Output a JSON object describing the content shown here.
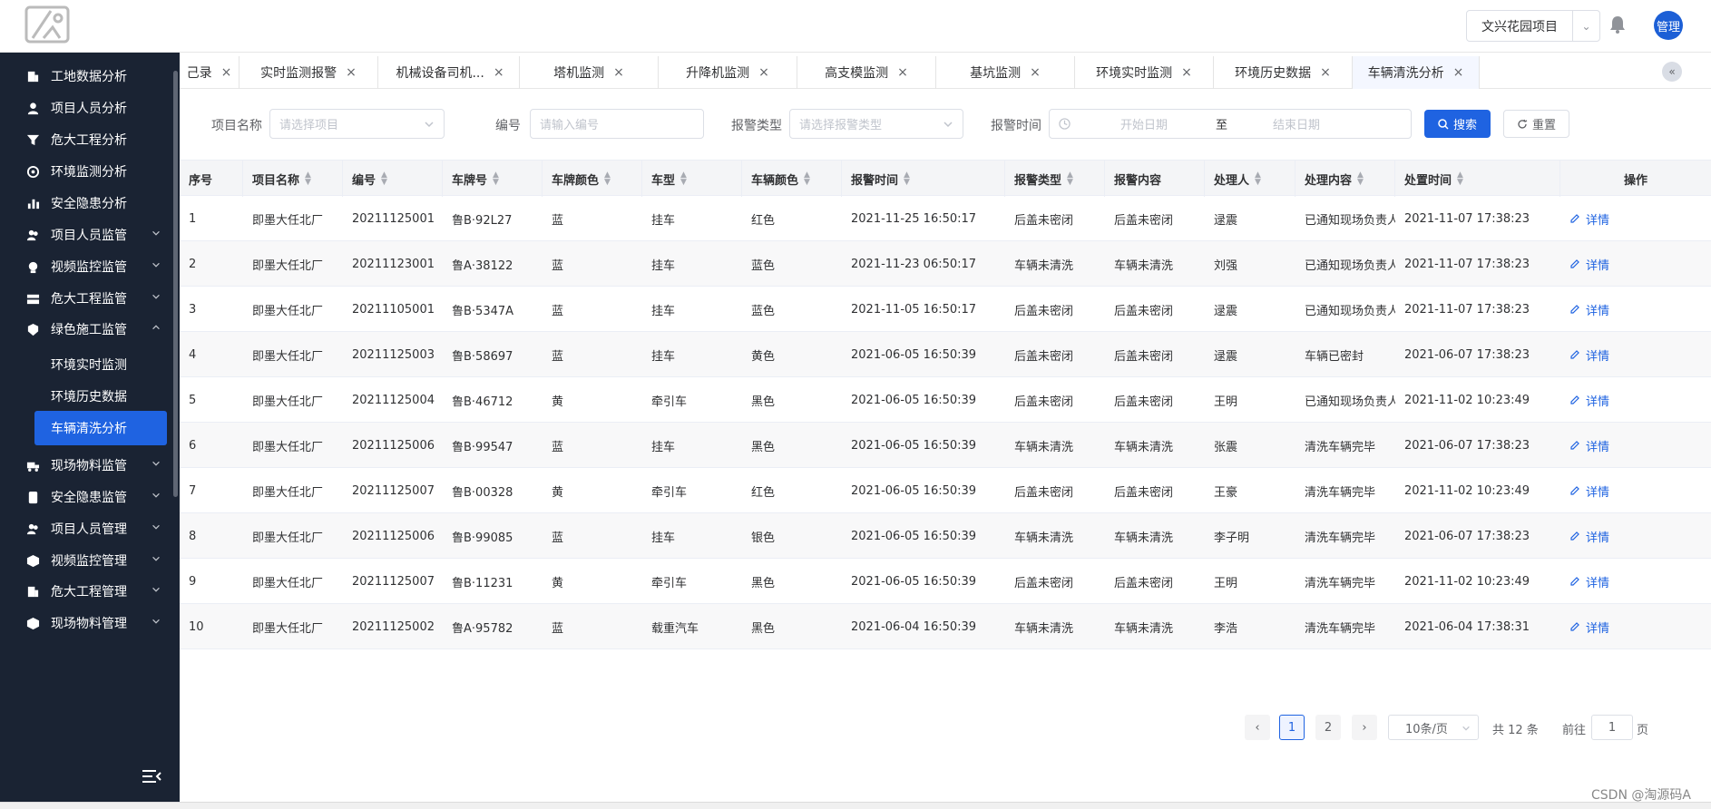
{
  "header": {
    "project_select": "文兴花园项目",
    "avatar_label": "管理"
  },
  "sidebar": {
    "items": [
      {
        "label": "工地数据分析",
        "icon": "building-icon",
        "has_chevron": false
      },
      {
        "label": "项目人员分析",
        "icon": "person-icon",
        "has_chevron": false
      },
      {
        "label": "危大工程分析",
        "icon": "filter-icon",
        "has_chevron": false
      },
      {
        "label": "环境监测分析",
        "icon": "fan-icon",
        "has_chevron": false
      },
      {
        "label": "安全隐患分析",
        "icon": "bar-chart-icon",
        "has_chevron": false
      },
      {
        "label": "项目人员监管",
        "icon": "people-icon",
        "has_chevron": true
      },
      {
        "label": "视频监控监管",
        "icon": "camera-icon",
        "has_chevron": true
      },
      {
        "label": "危大工程监管",
        "icon": "machine-icon",
        "has_chevron": true
      },
      {
        "label": "绿色施工监管",
        "icon": "leaf-icon",
        "has_chevron": true,
        "expanded": true
      },
      {
        "label": "现场物料监管",
        "icon": "truck-icon",
        "has_chevron": true
      },
      {
        "label": "安全隐患监管",
        "icon": "badge-icon",
        "has_chevron": true
      },
      {
        "label": "项目人员管理",
        "icon": "people-icon",
        "has_chevron": true
      },
      {
        "label": "视频监控管理",
        "icon": "cube-icon",
        "has_chevron": true
      },
      {
        "label": "危大工程管理",
        "icon": "building-icon",
        "has_chevron": true
      },
      {
        "label": "现场物料管理",
        "icon": "cube-icon",
        "has_chevron": true
      }
    ],
    "subitems": [
      {
        "label": "环境实时监测",
        "active": false
      },
      {
        "label": "环境历史数据",
        "active": false
      },
      {
        "label": "车辆清洗分析",
        "active": true
      }
    ]
  },
  "tabs": [
    {
      "label": "己录",
      "active": false
    },
    {
      "label": "实时监测报警",
      "active": false
    },
    {
      "label": "机械设备司机...",
      "active": false
    },
    {
      "label": "塔机监测",
      "active": false
    },
    {
      "label": "升降机监测",
      "active": false
    },
    {
      "label": "高支模监测",
      "active": false
    },
    {
      "label": "基坑监测",
      "active": false
    },
    {
      "label": "环境实时监测",
      "active": false
    },
    {
      "label": "环境历史数据",
      "active": false
    },
    {
      "label": "车辆清洗分析",
      "active": true
    }
  ],
  "filters": {
    "project_label": "项目名称",
    "project_placeholder": "请选择项目",
    "code_label": "编号",
    "code_placeholder": "请输入编号",
    "alarm_type_label": "报警类型",
    "alarm_type_placeholder": "请选择报警类型",
    "alarm_time_label": "报警时间",
    "start_placeholder": "开始日期",
    "range_sep": "至",
    "end_placeholder": "结束日期",
    "search_button": "搜索",
    "reset_button": "重置"
  },
  "table": {
    "headers": [
      "序号",
      "项目名称",
      "编号",
      "车牌号",
      "车牌颜色",
      "车型",
      "车辆颜色",
      "报警时间",
      "报警类型",
      "报警内容",
      "处理人",
      "处理内容",
      "处置时间",
      "操作"
    ],
    "rows": [
      [
        "1",
        "即墨大任北厂",
        "20211125001",
        "鲁B·92L27",
        "蓝",
        "挂车",
        "红色",
        "2021-11-25 16:50:17",
        "后盖未密闭",
        "后盖未密闭",
        "逯震",
        "已通知现场负责人",
        "2021-11-07 17:38:23",
        "详情"
      ],
      [
        "2",
        "即墨大任北厂",
        "20211123001",
        "鲁A·38122",
        "蓝",
        "挂车",
        "蓝色",
        "2021-11-23 06:50:17",
        "车辆未清洗",
        "车辆未清洗",
        "刘强",
        "已通知现场负责人",
        "2021-11-07 17:38:23",
        "详情"
      ],
      [
        "3",
        "即墨大任北厂",
        "20211105001",
        "鲁B·5347A",
        "蓝",
        "挂车",
        "蓝色",
        "2021-11-05 16:50:17",
        "后盖未密闭",
        "后盖未密闭",
        "逯震",
        "已通知现场负责人",
        "2021-11-07 17:38:23",
        "详情"
      ],
      [
        "4",
        "即墨大任北厂",
        "20211125003",
        "鲁B·58697",
        "蓝",
        "挂车",
        "黄色",
        "2021-06-05 16:50:39",
        "后盖未密闭",
        "后盖未密闭",
        "逯震",
        "车辆已密封",
        "2021-06-07 17:38:23",
        "详情"
      ],
      [
        "5",
        "即墨大任北厂",
        "20211125004",
        "鲁B·46712",
        "黄",
        "牵引车",
        "黑色",
        "2021-06-05 16:50:39",
        "后盖未密闭",
        "后盖未密闭",
        "王明",
        "已通知现场负责人",
        "2021-11-02 10:23:49",
        "详情"
      ],
      [
        "6",
        "即墨大任北厂",
        "20211125006",
        "鲁B·99547",
        "蓝",
        "挂车",
        "黑色",
        "2021-06-05 16:50:39",
        "车辆未清洗",
        "车辆未清洗",
        "张震",
        "清洗车辆完毕",
        "2021-06-07 17:38:23",
        "详情"
      ],
      [
        "7",
        "即墨大任北厂",
        "20211125007",
        "鲁B·00328",
        "黄",
        "牵引车",
        "红色",
        "2021-06-05 16:50:39",
        "后盖未密闭",
        "后盖未密闭",
        "王豪",
        "清洗车辆完毕",
        "2021-11-02 10:23:49",
        "详情"
      ],
      [
        "8",
        "即墨大任北厂",
        "20211125006",
        "鲁B·99085",
        "蓝",
        "挂车",
        "银色",
        "2021-06-05 16:50:39",
        "车辆未清洗",
        "车辆未清洗",
        "李子明",
        "清洗车辆完毕",
        "2021-06-07 17:38:23",
        "详情"
      ],
      [
        "9",
        "即墨大任北厂",
        "20211125007",
        "鲁B·11231",
        "黄",
        "牵引车",
        "黑色",
        "2021-06-05 16:50:39",
        "后盖未密闭",
        "后盖未密闭",
        "王明",
        "清洗车辆完毕",
        "2021-11-02 10:23:49",
        "详情"
      ],
      [
        "10",
        "即墨大任北厂",
        "20211125002",
        "鲁A·95782",
        "蓝",
        "载重汽车",
        "黑色",
        "2021-06-04 16:50:39",
        "车辆未清洗",
        "车辆未清洗",
        "李浩",
        "清洗车辆完毕",
        "2021-06-04 17:38:31",
        "详情"
      ]
    ]
  },
  "pagination": {
    "prev": "‹",
    "pages": [
      "1",
      "2"
    ],
    "next": "›",
    "page_size": "10条/页",
    "total": "共 12 条",
    "goto_label": "前往",
    "goto_value": "1",
    "page_unit": "页"
  },
  "watermark": "CSDN @淘源码A",
  "colors": {
    "sidebar_bg": "#1a2333",
    "accent": "#1f63e1"
  }
}
